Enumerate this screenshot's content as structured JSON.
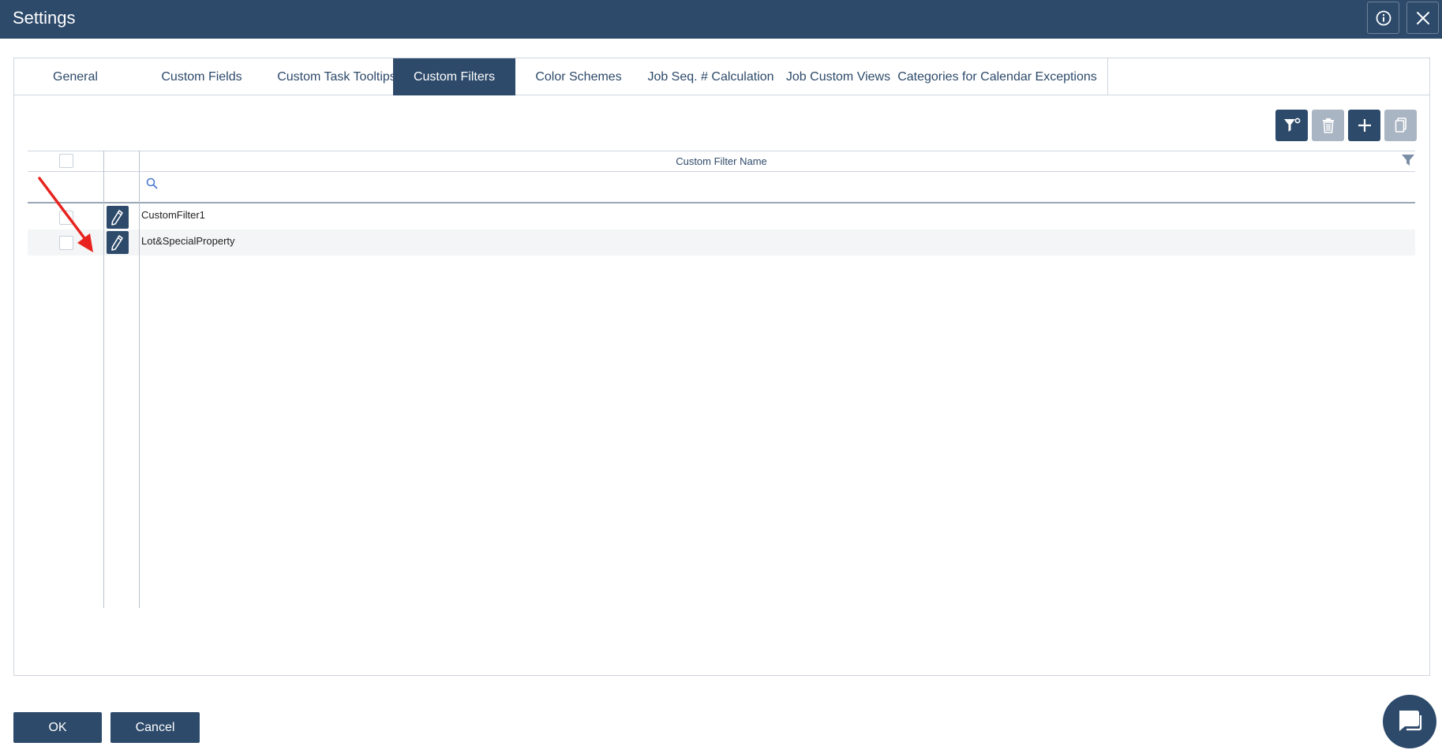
{
  "window": {
    "title": "Settings",
    "info_icon": "info-icon",
    "close_icon": "close-icon"
  },
  "tabs": [
    {
      "label": "General",
      "active": false
    },
    {
      "label": "Custom Fields",
      "active": false
    },
    {
      "label": "Custom Task Tooltips",
      "active": false
    },
    {
      "label": "Custom Filters",
      "active": true
    },
    {
      "label": "Color Schemes",
      "active": false
    },
    {
      "label": "Job Seq. # Calculation",
      "active": false
    },
    {
      "label": "Job Custom Views",
      "active": false
    },
    {
      "label": "Categories for Calendar Exceptions",
      "active": false
    }
  ],
  "toolbar": {
    "buttons": [
      {
        "icon": "filter-settings-icon",
        "enabled": true
      },
      {
        "icon": "trash-icon",
        "enabled": false
      },
      {
        "icon": "plus-icon",
        "enabled": true
      },
      {
        "icon": "copy-icon",
        "enabled": false
      }
    ]
  },
  "grid": {
    "column_header": "Custom Filter Name",
    "filter_icon": "filter-icon",
    "search_icon": "search-icon",
    "rows": [
      {
        "name": "CustomFilter1"
      },
      {
        "name": "Lot&SpecialProperty"
      }
    ]
  },
  "footer": {
    "ok_label": "OK",
    "cancel_label": "Cancel"
  },
  "chat": {
    "icon": "chat-icon"
  },
  "annotation": {
    "icon": "red-arrow-icon"
  },
  "colors": {
    "primary": "#2d4a6b",
    "disabled": "#a9b5c3",
    "arrow": "#e8231f"
  }
}
